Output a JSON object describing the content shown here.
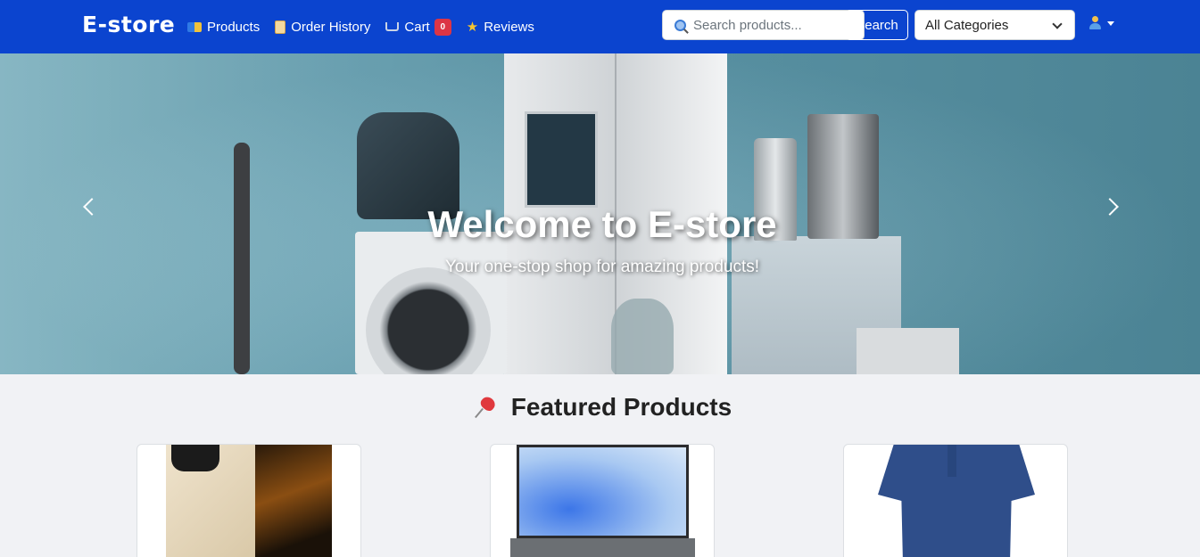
{
  "navbar": {
    "brand": "E-store",
    "links": [
      {
        "label": "Products",
        "icon": "products-icon"
      },
      {
        "label": "Order History",
        "icon": "scroll-icon"
      },
      {
        "label": "Cart",
        "icon": "cart-icon",
        "badge": "0"
      },
      {
        "label": "Reviews",
        "icon": "star-icon"
      }
    ],
    "search": {
      "placeholder": "Search products...",
      "value": "",
      "button_label": "Search"
    },
    "category": {
      "selected": "All Categories"
    },
    "user_icon": "user-icon"
  },
  "hero": {
    "title": "Welcome to E-store",
    "subtitle": "Your one-stop shop for amazing products!"
  },
  "featured": {
    "title": "Featured Products",
    "icon": "pushpin-icon",
    "products": [
      {
        "image": "smartphone"
      },
      {
        "image": "laptop"
      },
      {
        "image": "polo-shirt"
      }
    ]
  },
  "colors": {
    "navbar": "#0b44cf",
    "badge": "#dc3545",
    "page_bg": "#f1f2f5"
  }
}
